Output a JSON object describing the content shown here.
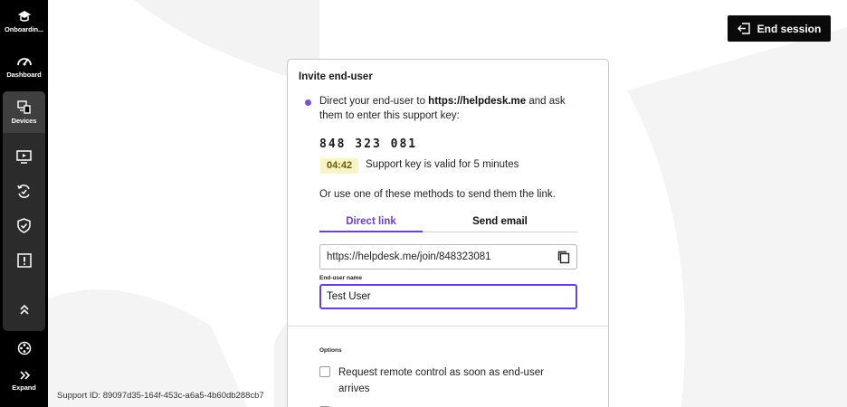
{
  "sidebar": {
    "items": [
      {
        "label": "Onboardin...",
        "icon": "graduation-cap-icon"
      },
      {
        "label": "Dashboard",
        "icon": "gauge-icon"
      },
      {
        "label": "Devices",
        "icon": "devices-icon"
      },
      {
        "label": "",
        "icon": "monitor-play-icon"
      },
      {
        "label": "",
        "icon": "sync-check-icon"
      },
      {
        "label": "",
        "icon": "shield-check-icon"
      },
      {
        "label": "",
        "icon": "alert-box-icon"
      },
      {
        "label": "",
        "icon": "double-chevron-up-icon"
      },
      {
        "label": "",
        "icon": "film-reel-icon"
      },
      {
        "label": "Expand",
        "icon": "double-chevron-right-icon"
      }
    ]
  },
  "header": {
    "end_session_label": "End session"
  },
  "invite": {
    "title": "Invite end-user",
    "instruction_prefix": "Direct your end-user to ",
    "url": "https://helpdesk.me",
    "instruction_suffix": " and ask them to enter this support key:",
    "support_key": "848 323 081",
    "timer": "04:42",
    "valid_text": "Support key is valid for 5 minutes",
    "methods_text": "Or use one of these methods to send them the link.",
    "tabs": [
      {
        "label": "Direct link",
        "active": true
      },
      {
        "label": "Send email",
        "active": false
      }
    ],
    "join_link": "https://helpdesk.me/join/848323081",
    "name_label": "End-user name",
    "name_value": "Test User",
    "options_label": "Options",
    "option_1": "Request remote control as soon as end-user arrives"
  },
  "footer": {
    "support_id": "Support ID: 89097d35-164f-453c-a6a5-4b60db288cb7"
  },
  "colors": {
    "accent": "#6a3fd6",
    "timer_bg": "#faf3c6",
    "sidebar_bg": "#000000"
  }
}
